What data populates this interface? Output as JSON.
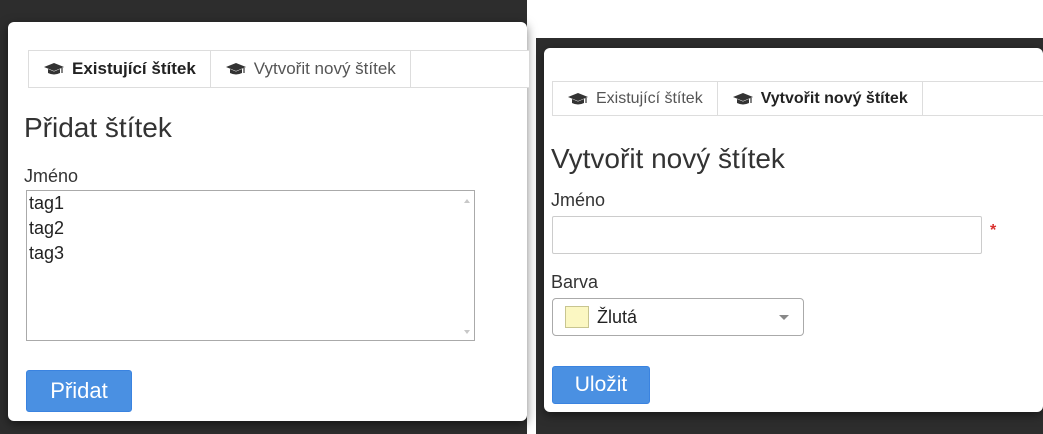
{
  "colors": {
    "primary": "#4a90e2",
    "required": "#d9302e",
    "swatch_yellow": "#fbf7c2"
  },
  "existing": {
    "tabs": [
      {
        "label": "Existující štítek",
        "icon": "graduation-cap-icon",
        "active": true
      },
      {
        "label": "Vytvořit nový štítek",
        "icon": "graduation-cap-icon",
        "active": false
      }
    ],
    "title": "Přidat štítek",
    "name_label": "Jméno",
    "options": [
      "tag1",
      "tag2",
      "tag3"
    ],
    "submit_label": "Přidat"
  },
  "create": {
    "tabs": [
      {
        "label": "Existující štítek",
        "icon": "graduation-cap-icon",
        "active": false
      },
      {
        "label": "Vytvořit nový štítek",
        "icon": "graduation-cap-icon",
        "active": true
      }
    ],
    "title": "Vytvořit nový štítek",
    "name_label": "Jméno",
    "name_value": "",
    "required_mark": "*",
    "color_label": "Barva",
    "color_value": "Žlutá",
    "submit_label": "Uložit"
  }
}
